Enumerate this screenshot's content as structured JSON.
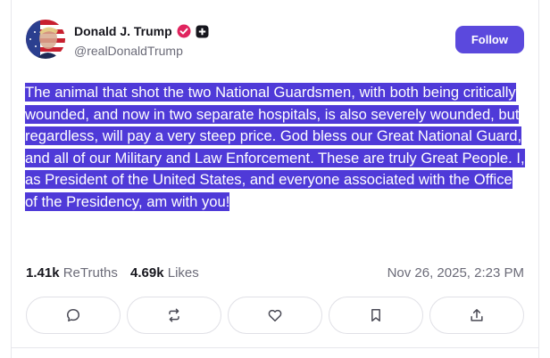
{
  "author": {
    "display_name": "Donald J. Trump",
    "handle": "@realDonaldTrump",
    "avatar_icon": "flag-portrait-avatar",
    "verified_icon": "verified-badge-icon",
    "extra_badge_icon": "plus-badge-icon"
  },
  "follow_label": "Follow",
  "post": {
    "text": "The animal that shot the two National Guardsmen, with both being critically wounded, and now in two separate hospitals, is also severely wounded, but regardless, will pay a very steep price. God bless our Great National Guard, and all of our Military and Law Enforcement. These are truly Great People. I, as President of the United States, and everyone associated with the Office of the Presidency, am with you!"
  },
  "stats": {
    "retruths_count": "1.41k",
    "retruths_label": "ReTruths",
    "likes_count": "4.69k",
    "likes_label": "Likes"
  },
  "timestamp": "Nov 26, 2025, 2:23 PM",
  "actions": [
    {
      "name": "reply",
      "icon": "comment-icon"
    },
    {
      "name": "retruth",
      "icon": "repost-icon"
    },
    {
      "name": "like",
      "icon": "heart-icon"
    },
    {
      "name": "bookmark",
      "icon": "bookmark-icon"
    },
    {
      "name": "share",
      "icon": "share-icon"
    }
  ],
  "colors": {
    "accent": "#5b49dd",
    "highlight": "#4f3ad8",
    "verified": "#e0245e"
  }
}
